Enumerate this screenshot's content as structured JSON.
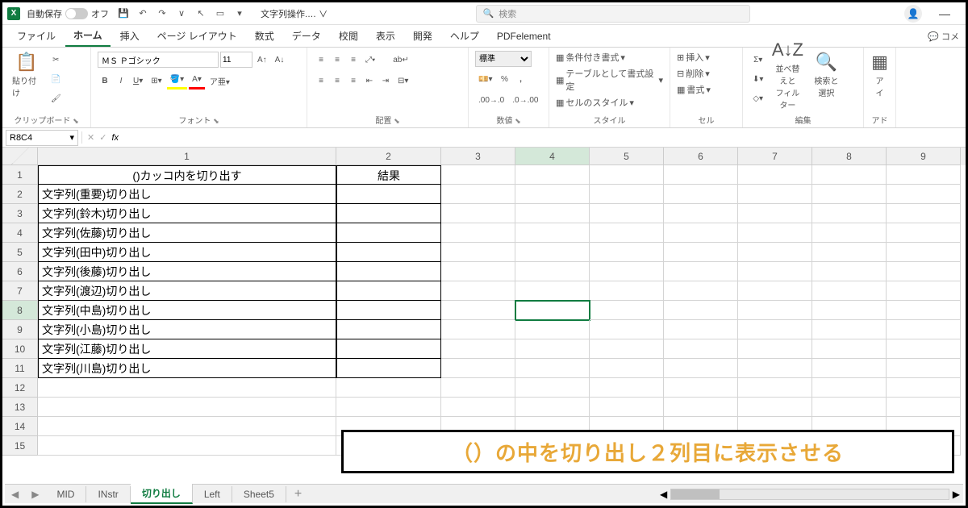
{
  "titlebar": {
    "autosave_label": "自動保存",
    "autosave_state": "オフ",
    "filename": "文字列操作.… ∨",
    "search_placeholder": "検索"
  },
  "tabs": {
    "file": "ファイル",
    "home": "ホーム",
    "insert": "挿入",
    "pagelayout": "ページ レイアウト",
    "formulas": "数式",
    "data": "データ",
    "review": "校閲",
    "view": "表示",
    "developer": "開発",
    "help": "ヘルプ",
    "pdf": "PDFelement",
    "comment": "コメ"
  },
  "ribbon": {
    "clipboard": {
      "paste": "貼り付け",
      "label": "クリップボード"
    },
    "font": {
      "name": "ＭＳ Ｐゴシック",
      "size": "11",
      "label": "フォント"
    },
    "alignment": {
      "label": "配置"
    },
    "number": {
      "format": "標準",
      "label": "数値"
    },
    "styles": {
      "cond": "条件付き書式",
      "table": "テーブルとして書式設定",
      "cell": "セルのスタイル",
      "label": "スタイル"
    },
    "cells": {
      "insert": "挿入",
      "delete": "削除",
      "format": "書式",
      "label": "セル"
    },
    "editing": {
      "sort": "並べ替えと\nフィルター",
      "find": "検索と\n選択",
      "label": "編集"
    },
    "addins": {
      "label": "アド"
    }
  },
  "namebox": "R8C4",
  "columns": [
    "1",
    "2",
    "3",
    "4",
    "5",
    "6",
    "7",
    "8",
    "9"
  ],
  "rows": [
    {
      "n": "1",
      "c1": "()カッコ内を切り出す",
      "c2": "結果",
      "header": true
    },
    {
      "n": "2",
      "c1": "文字列(重要)切り出し",
      "c2": ""
    },
    {
      "n": "3",
      "c1": "文字列(鈴木)切り出し",
      "c2": ""
    },
    {
      "n": "4",
      "c1": "文字列(佐藤)切り出し",
      "c2": ""
    },
    {
      "n": "5",
      "c1": "文字列(田中)切り出し",
      "c2": ""
    },
    {
      "n": "6",
      "c1": "文字列(後藤)切り出し",
      "c2": ""
    },
    {
      "n": "7",
      "c1": "文字列(渡辺)切り出し",
      "c2": ""
    },
    {
      "n": "8",
      "c1": "文字列(中島)切り出し",
      "c2": "",
      "selrow": true
    },
    {
      "n": "9",
      "c1": "文字列(小島)切り出し",
      "c2": ""
    },
    {
      "n": "10",
      "c1": "文字列(江藤)切り出し",
      "c2": ""
    },
    {
      "n": "11",
      "c1": "文字列(川島)切り出し",
      "c2": ""
    },
    {
      "n": "12",
      "c1": "",
      "c2": "",
      "empty": true
    },
    {
      "n": "13",
      "c1": "",
      "c2": "",
      "empty": true
    },
    {
      "n": "14",
      "c1": "",
      "c2": "",
      "empty": true
    },
    {
      "n": "15",
      "c1": "",
      "c2": "",
      "empty": true
    }
  ],
  "sheets": {
    "mid": "MID",
    "instr": "INstr",
    "kiridashi": "切り出し",
    "left": "Left",
    "sheet5": "Sheet5"
  },
  "annotation": "（）の中を切り出し２列目に表示させる"
}
